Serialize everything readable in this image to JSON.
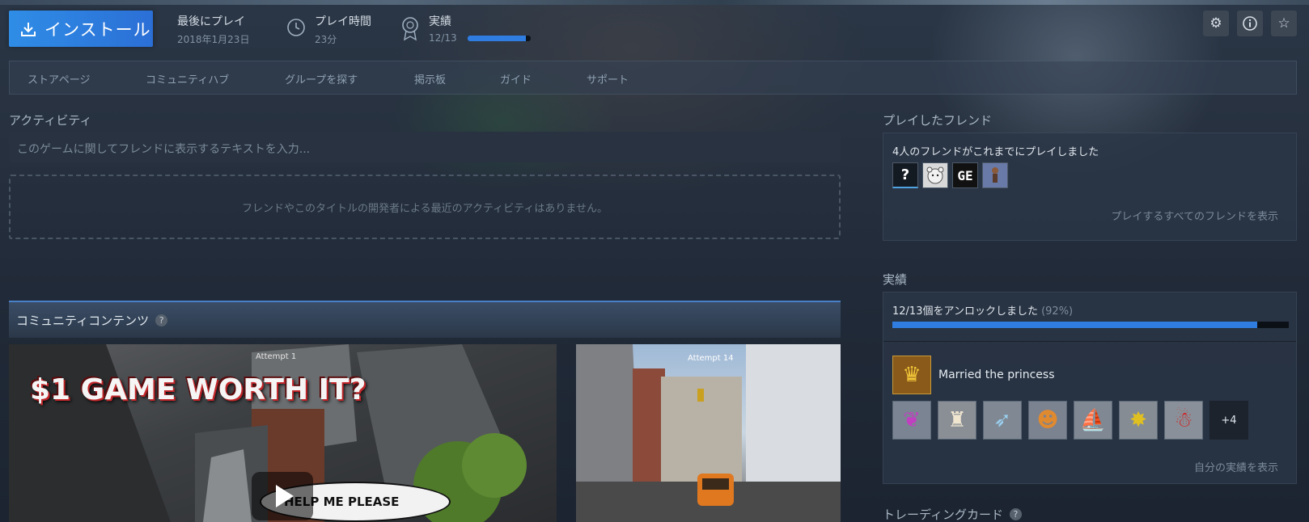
{
  "header": {
    "install_label": "インストール",
    "last_played_label": "最後にプレイ",
    "last_played_value": "2018年1月23日",
    "playtime_label": "プレイ時間",
    "playtime_value": "23分",
    "achievements_label": "実績",
    "achievements_value": "12/13",
    "achievements_progress": 0.92,
    "icons": [
      "gear-icon",
      "info-icon",
      "star-icon"
    ]
  },
  "nav": {
    "items": [
      "ストアページ",
      "コミュニティハブ",
      "グループを探す",
      "掲示板",
      "ガイド",
      "サポート"
    ]
  },
  "activity": {
    "title": "アクティビティ",
    "input_placeholder": "このゲームに関してフレンドに表示するテキストを入力...",
    "empty_message": "フレンドやこのタイトルの開発者による最近のアクティビティはありません。"
  },
  "community": {
    "title": "コミュニティコンテンツ",
    "help": "?",
    "video1": {
      "caption": "Attempt 1",
      "headline": "$1 GAME WORTH IT?",
      "bubble": "HELP ME PLEASE"
    },
    "video2": {
      "caption": "Attempt 14"
    }
  },
  "friends": {
    "title": "プレイしたフレンド",
    "summary": "4人のフレンドがこれまでにプレイしました",
    "avatars": [
      "?",
      "",
      "GE",
      ""
    ],
    "show_all": "プレイするすべてのフレンドを表示"
  },
  "achievements": {
    "title": "実績",
    "unlocked_text": "12/13個をアンロックしました",
    "percent_text": "(92%)",
    "progress": 0.92,
    "featured_name": "Married the princess",
    "more_count": "+4",
    "show_mine": "自分の実績を表示"
  },
  "trading_cards": {
    "title": "トレーディングカード",
    "help": "?"
  },
  "colors": {
    "accent": "#2f7de0",
    "install": "#2b6fd6"
  }
}
